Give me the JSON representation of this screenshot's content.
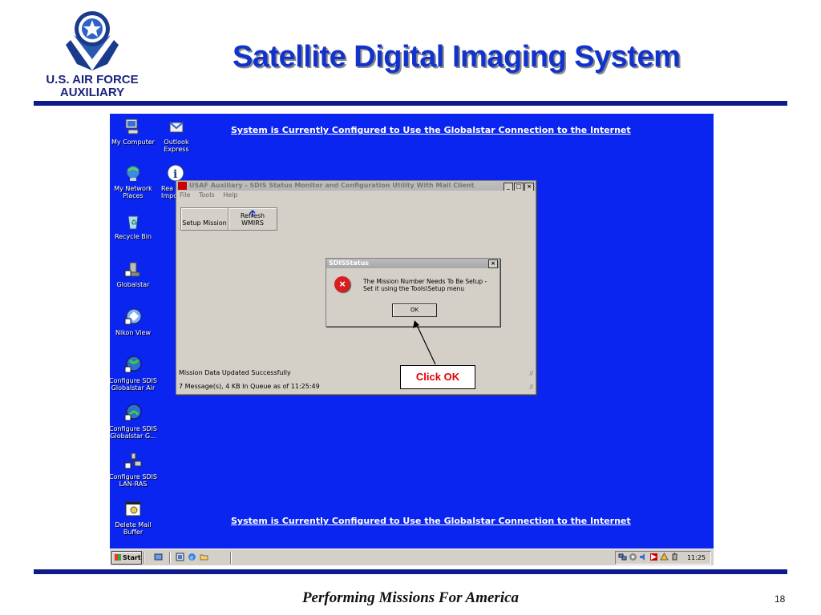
{
  "slide": {
    "logo_line1": "U.S. AIR FORCE",
    "logo_line2": "AUXILIARY",
    "title": "Satellite Digital Imaging System",
    "footer": "Performing Missions For America",
    "page_number": "18"
  },
  "desktop": {
    "banner_top": "System is Currently Configured to Use the Globalstar Connection to the Internet",
    "banner_bottom": "System is Currently Configured to Use the Globalstar Connection to the Internet",
    "icons": [
      {
        "label": "My Computer",
        "icon": "computer-icon"
      },
      {
        "label": "Outlook Express",
        "icon": "outlook-icon"
      },
      {
        "label": "My Network Places",
        "icon": "network-icon"
      },
      {
        "label": "Rea Impo",
        "icon": "info-icon"
      },
      {
        "label": "Recycle Bin",
        "icon": "recycle-bin-icon"
      },
      {
        "label": "Globalstar",
        "icon": "globalstar-icon"
      },
      {
        "label": "Nikon View",
        "icon": "nikon-icon"
      },
      {
        "label": "Configure SDIS Globalstar Air",
        "icon": "globe-icon"
      },
      {
        "label": "Configure SDIS Globalstar G...",
        "icon": "globe-icon"
      },
      {
        "label": "Configure SDIS LAN-RAS",
        "icon": "lan-icon"
      },
      {
        "label": "Delete Mail Buffer",
        "icon": "mail-buffer-icon"
      }
    ]
  },
  "app_window": {
    "title": "USAF Auxiliary - SDIS Status Monitor and Configuration Utility With Mail Client",
    "menu": [
      "File",
      "Tools",
      "Help"
    ],
    "buttons": {
      "setup": "Setup Mission",
      "refresh": "Refresh WMIRS"
    },
    "status_line1": "Mission Data Updated Successfully",
    "status_line2": "7 Message(s), 4 KB In Queue as of 11:25:49"
  },
  "dialog": {
    "title": "SDISStatus",
    "message": "The Mission Number Needs To Be Setup - Set it using the Tools\\Setup menu",
    "ok_label": "OK"
  },
  "callout": {
    "text": "Click OK"
  },
  "taskbar": {
    "start_label": "Start",
    "clock": "11:25"
  },
  "colors": {
    "desktop": "#0a25f0",
    "title_blue": "#1133cc",
    "rule": "#0d1a8c",
    "callout_red": "#e00000"
  }
}
